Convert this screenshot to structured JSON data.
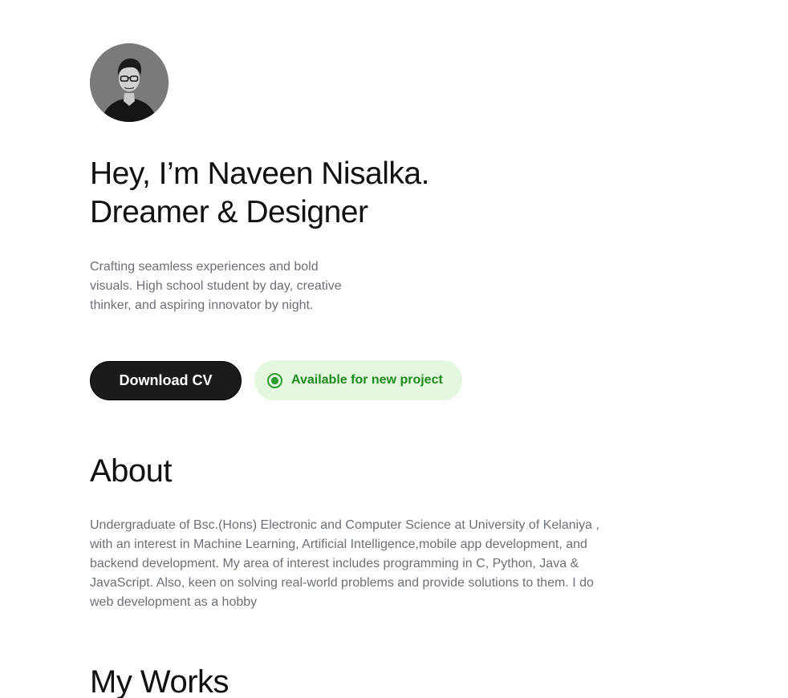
{
  "hero": {
    "avatar_icon": "profile-photo",
    "title_line1": "Hey, I’m Naveen Nisalka.",
    "title_line2": "Dreamer & Designer",
    "description": "Crafting seamless experiences and bold visuals. High school student by day, creative thinker, and aspiring innovator by night."
  },
  "actions": {
    "download_label": "Download CV",
    "availability_label": "Available for new project",
    "availability_icon": "radio-dot-icon",
    "availability_color": "#1f8a1f",
    "availability_bg": "#e3f8de"
  },
  "about": {
    "title": "About",
    "text": "Undergraduate of Bsc.(Hons) Electronic and Computer Science at University of Kelaniya , with an interest in Machine Learning, Artificial Intelligence,mobile app development, and backend development. My area of interest includes programming in C, Python, Java & JavaScript. Also, keen on solving real-world problems and provide solutions to them. I do web development as a hobby"
  },
  "works": {
    "title": "My Works"
  }
}
